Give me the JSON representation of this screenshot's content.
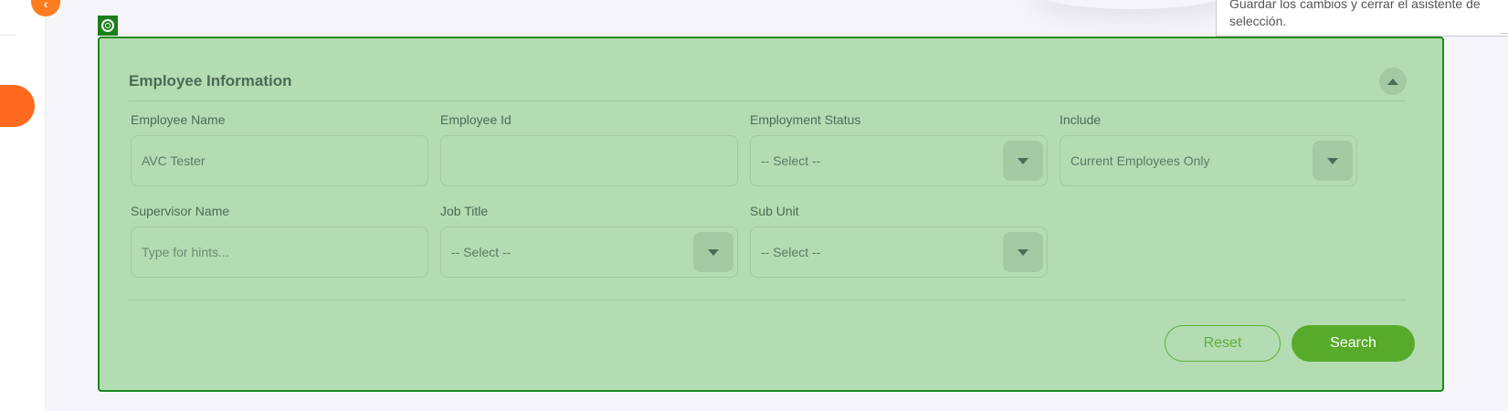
{
  "tooltip": {
    "line1": "Guardar los cambios y cerrar el asistente de",
    "line2": "selección."
  },
  "sidebar": {
    "collapse_glyph": "‹"
  },
  "panel": {
    "title": "Employee Information",
    "fields": [
      {
        "label": "Employee Name",
        "value": "AVC Tester",
        "type": "input"
      },
      {
        "label": "Employee Id",
        "value": "",
        "type": "input"
      },
      {
        "label": "Employment Status",
        "value": "-- Select --",
        "type": "select"
      },
      {
        "label": "Include",
        "value": "Current Employees Only",
        "type": "select"
      },
      {
        "label": "Supervisor Name",
        "placeholder": "Type for hints...",
        "value": "",
        "type": "input"
      },
      {
        "label": "Job Title",
        "value": "-- Select --",
        "type": "select"
      },
      {
        "label": "Sub Unit",
        "value": "-- Select --",
        "type": "select"
      }
    ],
    "buttons": {
      "reset": "Reset",
      "search": "Search"
    }
  },
  "colors": {
    "accent_orange": "#ff6a1f",
    "highlight_green": "#b3dcb3",
    "highlight_border": "#1a8a1a",
    "primary_green": "#58ab2a"
  }
}
